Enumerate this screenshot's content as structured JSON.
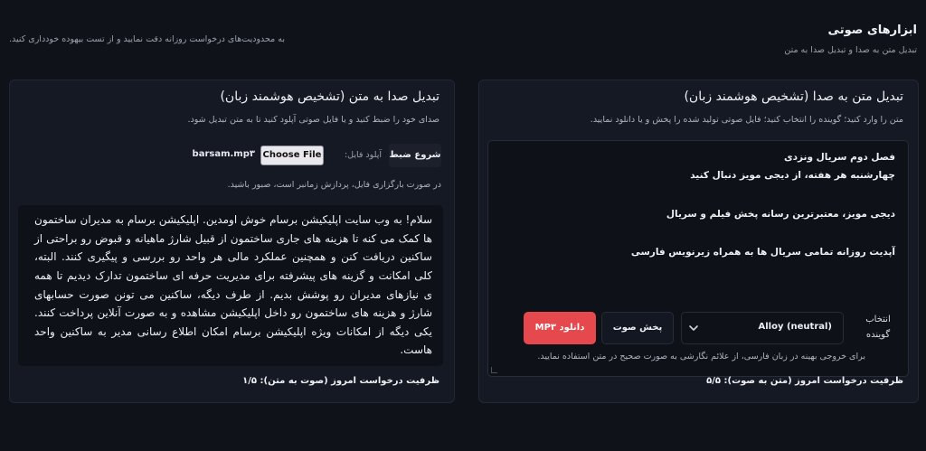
{
  "header": {
    "title": "ابزارهای صوتی",
    "subtitle": "تبدیل متن به صدا و تبدیل صدا به متن",
    "notice": "به محدودیت‌های درخواست روزانه دقت نمایید و از تست بیهوده خودداری کنید."
  },
  "tts": {
    "title": "تبدیل متن به صدا (تشخیص هوشمند زبان)",
    "description": "متن را وارد کنید؛ گوینده را انتخاب کنید؛ فایل صوتی تولید شده را پخش و یا دانلود نمایید.",
    "text_lines": [
      "فصل دوم سریال ونزدی",
      "چهارشنبه هر هفته، از دیجی مویز دنبال کنید",
      "",
      "دیجی مویز، معتبرترین رسانه پخش فیلم و سریال",
      "",
      "آپدیت روزانه تمامی سریال ها به همراه زیرنویس فارسی"
    ],
    "voice_label": "انتخاب گوینده",
    "voice_selected": "Alloy (neutral)",
    "play_label": "پخش صوت",
    "download_label": "دانلود MP۳",
    "hint": "برای خروجی بهینه در زبان فارسی، از علائم نگارشی به صورت صحیح در متن استفاده نمایید.",
    "capacity": "ظرفیت درخواست امروز (متن به صوت): ۵/۵"
  },
  "stt": {
    "title": "تبدیل صدا به متن (تشخیص هوشمند زبان)",
    "description": "صدای خود را ضبط کنید و یا فایل صوتی آپلود کنید تا به متن تبدیل شود.",
    "record_label": "شروع ضبط",
    "upload_label": "آپلود فایل:",
    "choose_file_label": "Choose File",
    "file_name": "barsam.mp۳",
    "upload_hint": "در صورت بارگزاری فایل، پردازش زمانبر است، صبور باشید.",
    "result_text": "سلام! به وب سایت اپلیکیشن برسام خوش اومدین. اپلیکیشن برسام به مدیران ساختمون ها کمک می کنه تا هزینه های جاری ساختمون از قبیل شارژ ماهیانه و قبوض رو براحتی از ساکنین دریافت کنن و همچنین عملکرد مالی هر واحد رو بررسی و پیگیری کنند. البته، کلی امکانت و گزینه های پیشرفته برای مدیریت حرفه ای ساختمون تدارک دیدیم تا همه ی نیازهای مدیران رو پوشش بدیم. از طرف دیگه، ساکنین می تونن صورت حسابهای شارژ و هزینه های ساختمون رو داخل اپلیکیشن مشاهده و به صورت آنلاین پرداخت کنند. یکی دیگه از امکانات ویژه اپلیکیشن برسام امکان اطلاع رسانی مدیر به ساکنین واحد هاست.",
    "capacity": "ظرفیت درخواست امروز (صوت به متن): ۱/۵"
  },
  "icons": {
    "voice_dropdown": "chevron-down-icon"
  },
  "colors": {
    "background": "#0f1219",
    "panel": "#151923",
    "accent": "#e5484d"
  }
}
